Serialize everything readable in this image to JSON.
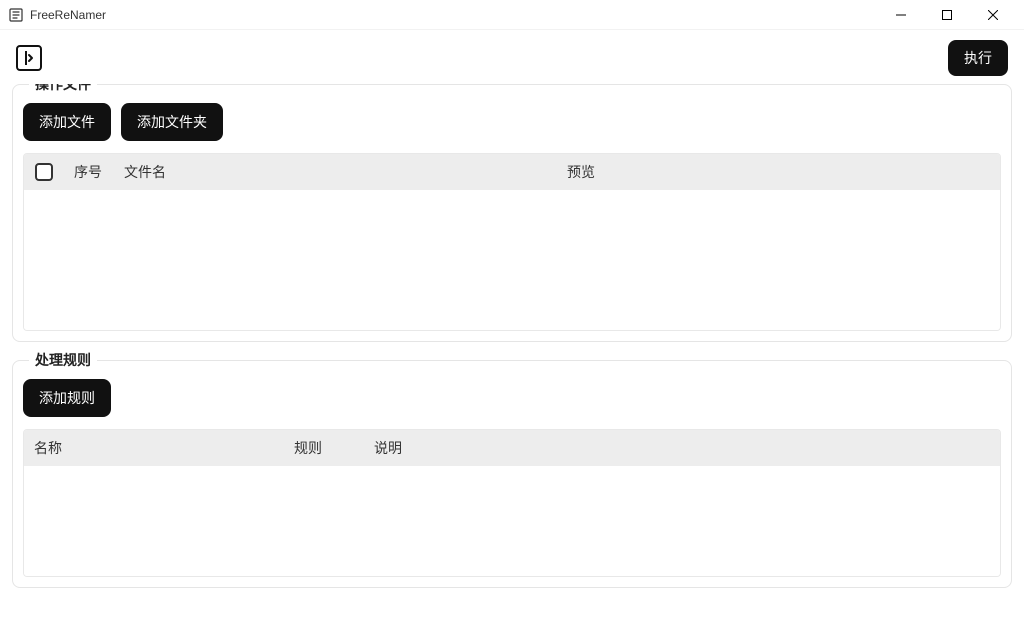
{
  "window": {
    "title": "FreeReNamer"
  },
  "toolbar": {
    "execute_label": "执行"
  },
  "files_section": {
    "title": "操作文件",
    "add_file_label": "添加文件",
    "add_folder_label": "添加文件夹",
    "columns": {
      "seq": "序号",
      "filename": "文件名",
      "preview": "预览"
    },
    "rows": []
  },
  "rules_section": {
    "title": "处理规则",
    "add_rule_label": "添加规则",
    "columns": {
      "name": "名称",
      "rule": "规则",
      "desc": "说明"
    },
    "rows": []
  }
}
